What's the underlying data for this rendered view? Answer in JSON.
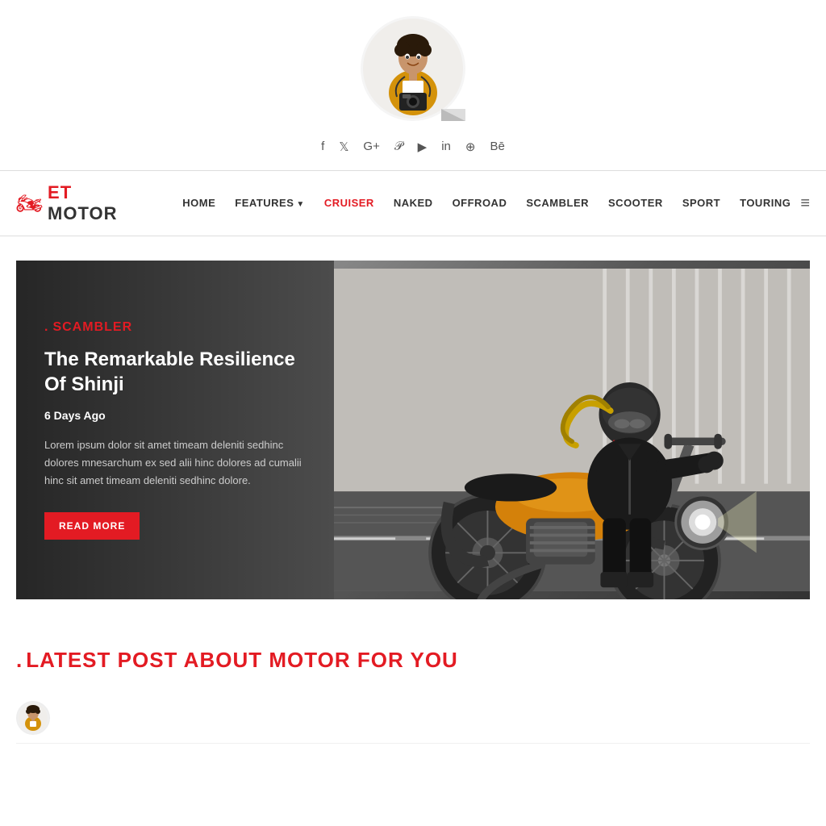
{
  "brand": {
    "logo_et": "ET",
    "logo_motor": " MOTOR",
    "logo_icon": "🏍"
  },
  "social": {
    "icons": [
      "f",
      "𝕏",
      "G+",
      "℗",
      "▶",
      "in",
      "⊕",
      "Bē"
    ]
  },
  "nav": {
    "items": [
      {
        "label": "HOME",
        "active": false
      },
      {
        "label": "FEATURES",
        "active": false,
        "has_dropdown": true
      },
      {
        "label": "CRUISER",
        "active": true
      },
      {
        "label": "NAKED",
        "active": false
      },
      {
        "label": "OFFROAD",
        "active": false
      },
      {
        "label": "SCAMBLER",
        "active": false
      },
      {
        "label": "SCOOTER",
        "active": false
      },
      {
        "label": "SPORT",
        "active": false
      },
      {
        "label": "TOURING",
        "active": false
      }
    ]
  },
  "hero": {
    "category": "SCAMBLER",
    "title": "The Remarkable Resilience Of Shinji",
    "date": "6 Days Ago",
    "excerpt": "Lorem ipsum dolor sit amet timeam deleniti sedhinc dolores mnesarchum ex sed alii hinc dolores ad cumalii hinc sit amet timeam deleniti sedhinc dolore.",
    "read_more": "READ MORE"
  },
  "latest": {
    "section_title": "LATEST POST ABOUT MOTOR FOR YOU"
  },
  "colors": {
    "accent": "#e31b23",
    "dark": "#333",
    "light_bg": "#f5f5f5"
  }
}
